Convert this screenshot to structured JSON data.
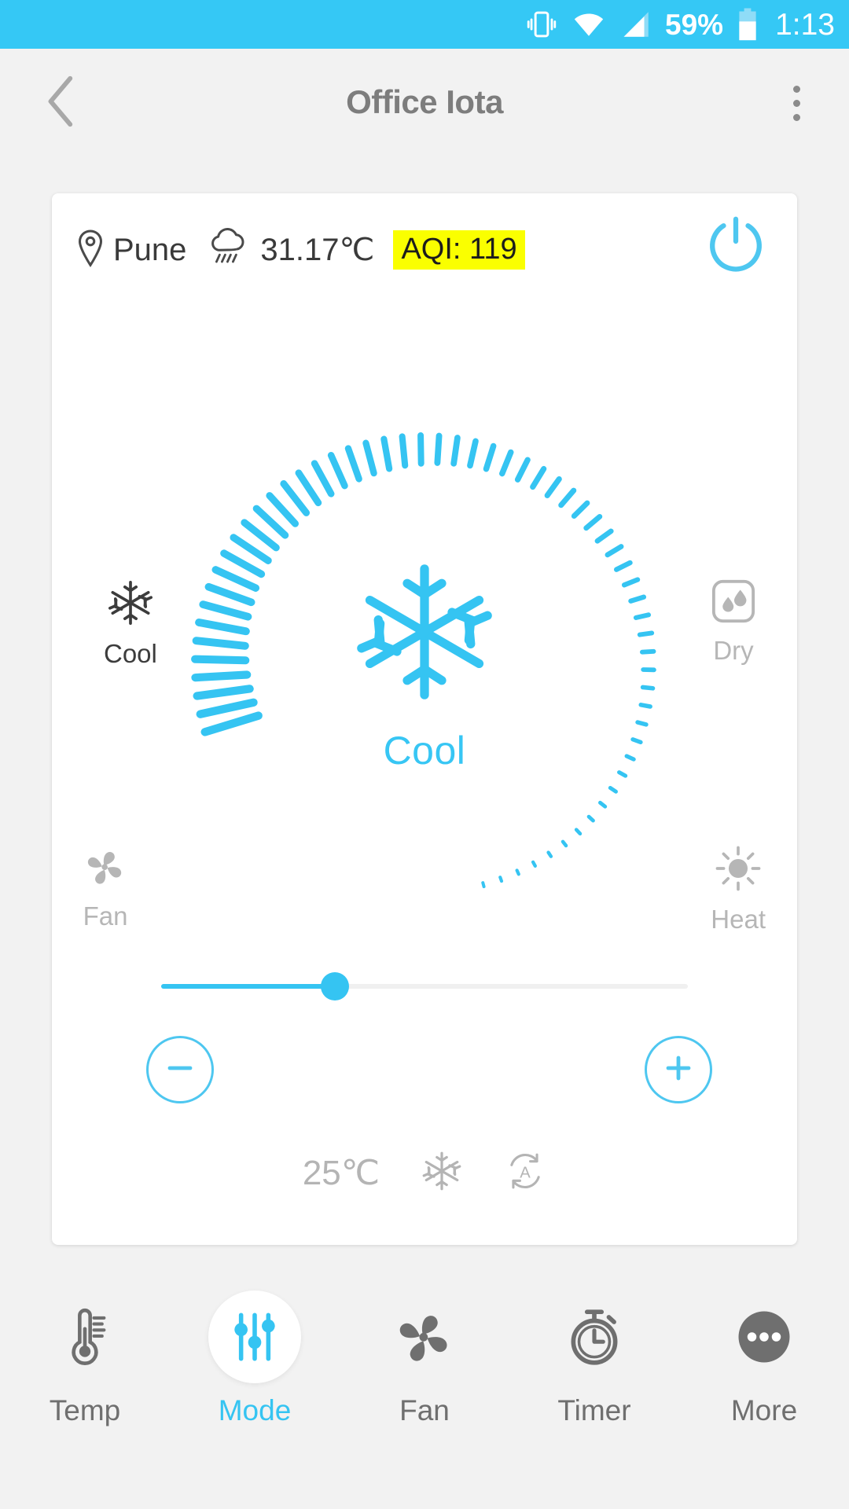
{
  "statusbar": {
    "battery_percent": "59%",
    "clock": "1:13",
    "icons": [
      "vibrate-icon",
      "wifi-icon",
      "cellular-signal-icon",
      "battery-icon"
    ],
    "background": "#35c8f5"
  },
  "appbar": {
    "title": "Office Iota",
    "back_icon": "chevron-left-icon",
    "overflow_icon": "more-vertical-icon"
  },
  "card": {
    "weather": {
      "location_icon": "location-pin-icon",
      "city": "Pune",
      "weather_icon": "rain-cloud-icon",
      "temperature": "31.17℃",
      "aqi": "AQI: 119",
      "aqi_highlight_color": "#faff00"
    },
    "power": {
      "icon": "power-icon",
      "state": "on",
      "color": "#4ec7f0"
    },
    "modes": [
      {
        "key": "cool",
        "label": "Cool",
        "icon": "snowflake-icon",
        "active": true,
        "position": "top-left"
      },
      {
        "key": "dry",
        "label": "Dry",
        "icon": "humidity-drops-icon",
        "active": false,
        "position": "top-right"
      },
      {
        "key": "fan",
        "label": "Fan",
        "icon": "fan-blades-icon",
        "active": false,
        "position": "bottom-left"
      },
      {
        "key": "heat",
        "label": "Heat",
        "icon": "sun-icon",
        "active": false,
        "position": "bottom-right"
      }
    ],
    "dial": {
      "center_icon": "snowflake-icon",
      "center_label": "Cool",
      "accent_color": "#35c4f2",
      "tick_count": 60
    },
    "slider": {
      "value_percent": 33,
      "fill_color": "#35c4f2",
      "track_color": "#f0f0f0"
    },
    "stepper": {
      "minus_label": "−",
      "minus_icon": "minus-circle-icon",
      "plus_label": "+",
      "plus_icon": "plus-circle-icon"
    },
    "status_row": {
      "setpoint": "25℃",
      "mode_icon": "snowflake-icon",
      "fan_icon": "auto-fan-icon"
    }
  },
  "bottom_nav": {
    "items": [
      {
        "key": "temp",
        "label": "Temp",
        "icon": "thermometer-icon",
        "active": false
      },
      {
        "key": "mode",
        "label": "Mode",
        "icon": "sliders-icon",
        "active": true
      },
      {
        "key": "fan",
        "label": "Fan",
        "icon": "fan-blades-icon",
        "active": false
      },
      {
        "key": "timer",
        "label": "Timer",
        "icon": "stopwatch-icon",
        "active": false
      },
      {
        "key": "more",
        "label": "More",
        "icon": "ellipsis-circle-icon",
        "active": false
      }
    ],
    "active_color": "#35c4f2",
    "inactive_color": "#6f6f6f"
  }
}
